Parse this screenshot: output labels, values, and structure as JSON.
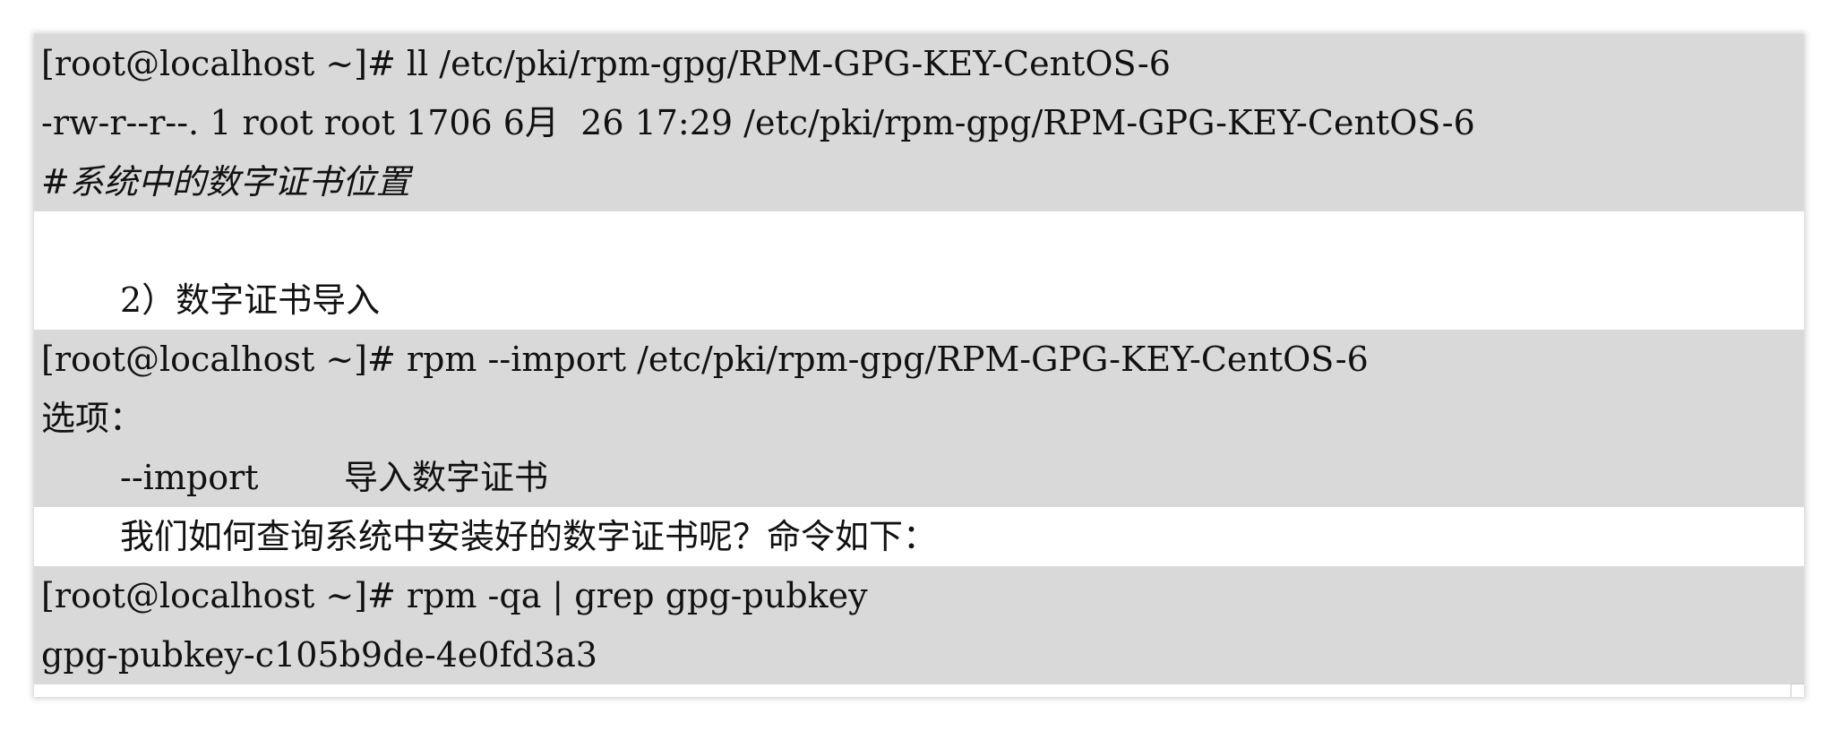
{
  "block1": {
    "cmd": "[root@localhost ~]# ll /etc/pki/rpm-gpg/RPM-GPG-KEY-CentOS-6",
    "output": "-rw-r--r--. 1 root root 1706 6月  26 17:29 /etc/pki/rpm-gpg/RPM-GPG-KEY-CentOS-6",
    "comment": "#系统中的数字证书位置"
  },
  "section_heading": "2）数字证书导入",
  "block2": {
    "cmd": "[root@localhost ~]# rpm --import /etc/pki/rpm-gpg/RPM-GPG-KEY-CentOS-6",
    "options_label": "选项：",
    "option_flag": "--import",
    "option_desc": "导入数字证书"
  },
  "paragraph": "我们如何查询系统中安装好的数字证书呢？命令如下：",
  "block3": {
    "cmd": "[root@localhost ~]# rpm -qa | grep gpg-pubkey",
    "output": "gpg-pubkey-c105b9de-4e0fd3a3"
  }
}
